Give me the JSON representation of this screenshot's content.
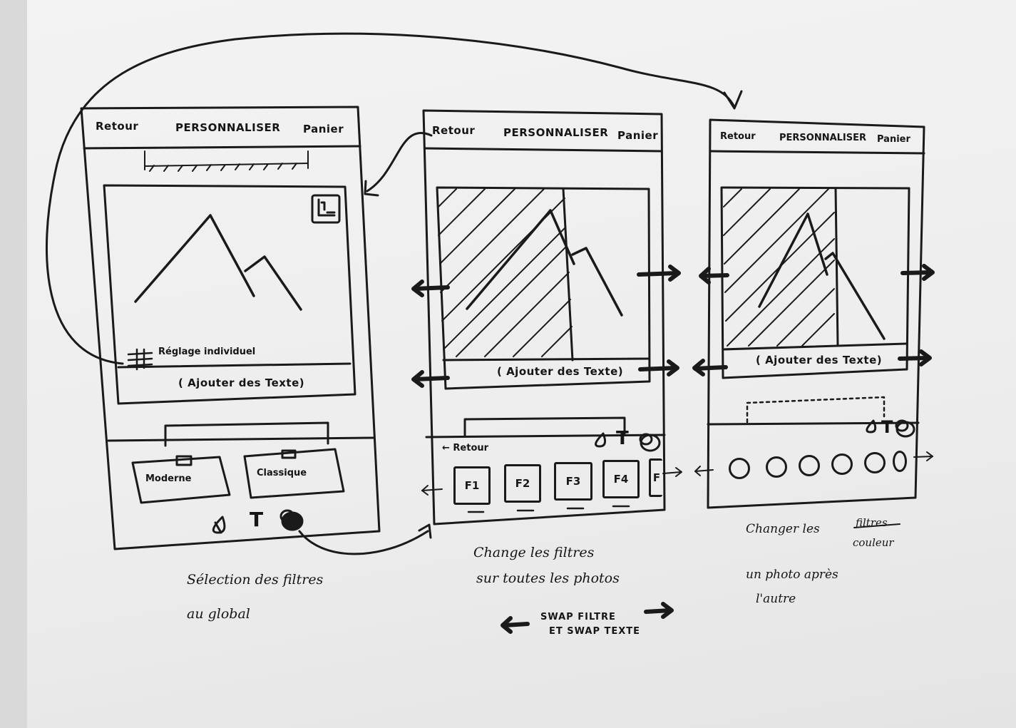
{
  "screen1": {
    "header": {
      "back": "Retour",
      "title": "PERSONNALISER",
      "cart": "Panier"
    },
    "individual_label": "Réglage individuel",
    "add_text": "( Ajouter des Texte)",
    "filter_buttons": [
      "Moderne",
      "Classique"
    ],
    "toolbar_text_icon": "T",
    "caption": [
      "Sélection des filtres",
      "au global"
    ]
  },
  "screen2": {
    "header": {
      "back": "Retour",
      "title": "PERSONNALISER",
      "cart": "Panier"
    },
    "add_text": "( Ajouter des Texte)",
    "back_link": "← Retour",
    "toolbar_text_icon": "T",
    "filters": [
      "F1",
      "F2",
      "F3",
      "F4",
      "F"
    ],
    "caption": [
      "Change les filtres",
      "sur toutes les photos"
    ],
    "swap_note": [
      "SWAP FILTRE",
      "ET SWAP TEXTE"
    ]
  },
  "screen3": {
    "header": {
      "back": "Retour",
      "title": "PERSONNALISER",
      "cart": "Panier"
    },
    "add_text": "( Ajouter des Texte)",
    "toolbar_text_icon": "T",
    "caption_line1": "Changer les",
    "caption_struck": "filtres",
    "caption_replacement": "couleur",
    "caption_rest": [
      "un photo après",
      "l'autre"
    ]
  },
  "icons": [
    "crop-icon",
    "sliders-icon",
    "drop-icon",
    "text-icon",
    "color-icon",
    "swap-arrow-icon",
    "flow-arrow-icon"
  ]
}
